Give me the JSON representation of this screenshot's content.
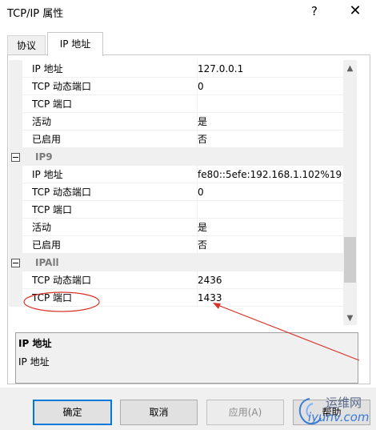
{
  "window": {
    "title": "TCP/IP 属性",
    "help": "?",
    "close": "✕"
  },
  "tabs": [
    {
      "label": "协议"
    },
    {
      "label": "IP 地址"
    }
  ],
  "grid": {
    "rows": [
      {
        "type": "prop",
        "name": "IP 地址",
        "value": "127.0.0.1"
      },
      {
        "type": "prop",
        "name": "TCP 动态端口",
        "value": "0"
      },
      {
        "type": "prop",
        "name": "TCP 端口",
        "value": ""
      },
      {
        "type": "prop",
        "name": "活动",
        "value": "是"
      },
      {
        "type": "prop",
        "name": "已启用",
        "value": "否"
      },
      {
        "type": "cat",
        "name": "IP9"
      },
      {
        "type": "prop",
        "name": "IP 地址",
        "value": "fe80::5efe:192.168.1.102%19"
      },
      {
        "type": "prop",
        "name": "TCP 动态端口",
        "value": "0"
      },
      {
        "type": "prop",
        "name": "TCP 端口",
        "value": ""
      },
      {
        "type": "prop",
        "name": "活动",
        "value": "是"
      },
      {
        "type": "prop",
        "name": "已启用",
        "value": "否"
      },
      {
        "type": "cat",
        "name": "IPAll"
      },
      {
        "type": "prop",
        "name": "TCP 动态端口",
        "value": "2436"
      },
      {
        "type": "prop",
        "name": "TCP 端口",
        "value": "1433"
      }
    ],
    "scroll_position": 0.85
  },
  "description": {
    "title": "IP 地址",
    "text": "IP 地址"
  },
  "buttons": {
    "ok": "确定",
    "cancel": "取消",
    "apply": "应用(A)",
    "help": "帮助"
  },
  "watermark": {
    "line1": "运维网",
    "line2": "iyunv.com"
  },
  "colors": {
    "accent": "#0078d7",
    "annotation": "#d9342b",
    "category_bg": "#f0f0f0"
  }
}
